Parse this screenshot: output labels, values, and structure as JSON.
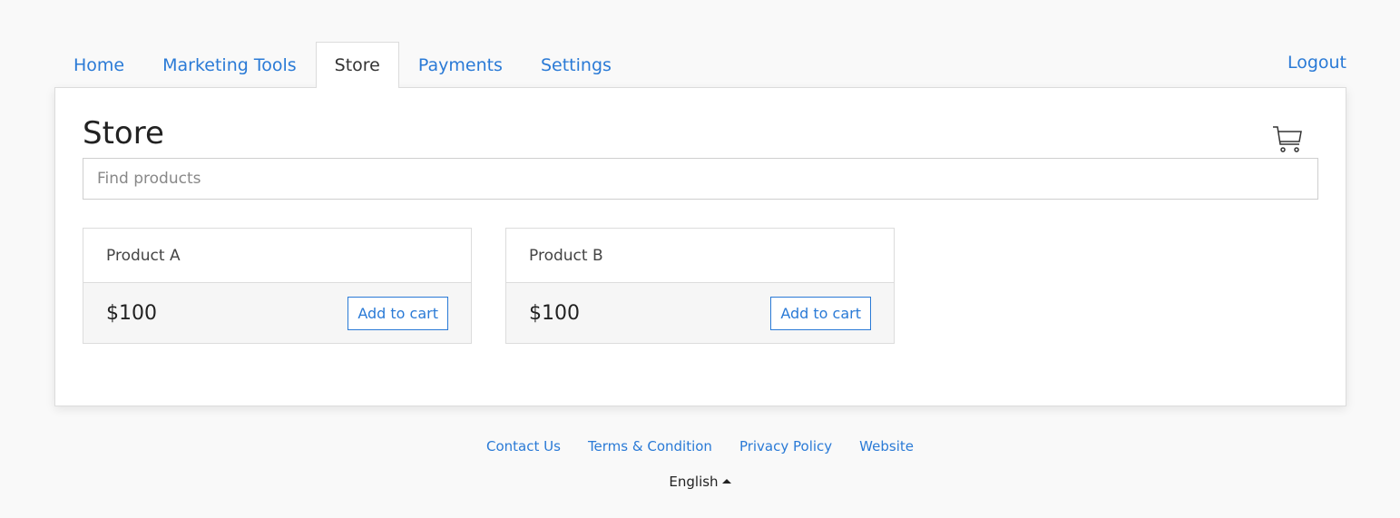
{
  "nav": {
    "tabs": [
      {
        "label": "Home",
        "active": false
      },
      {
        "label": "Marketing Tools",
        "active": false
      },
      {
        "label": "Store",
        "active": true
      },
      {
        "label": "Payments",
        "active": false
      },
      {
        "label": "Settings",
        "active": false
      }
    ],
    "logout_label": "Logout"
  },
  "store": {
    "title": "Store",
    "cart_icon": "shopping-cart-icon",
    "search_placeholder": "Find products",
    "search_value": "",
    "products": [
      {
        "name": "Product A",
        "price": "$100",
        "button_label": "Add to cart"
      },
      {
        "name": "Product B",
        "price": "$100",
        "button_label": "Add to cart"
      }
    ]
  },
  "footer": {
    "links": [
      "Contact Us",
      "Terms & Condition",
      "Privacy Policy",
      "Website"
    ],
    "language": "English"
  },
  "colors": {
    "accent": "#2a7ad6",
    "background": "#f9f9f9",
    "panel": "#ffffff",
    "card_footer": "#f6f6f6"
  }
}
